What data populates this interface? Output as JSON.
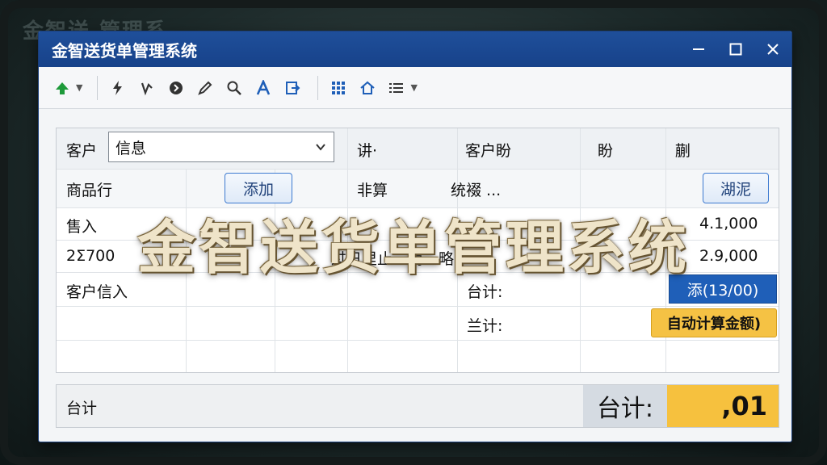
{
  "background": {
    "title": "金智送 管理系"
  },
  "window": {
    "title": "金智送货单管理系统"
  },
  "toolbar": {
    "icons": [
      "up-arrow-icon",
      "dropdown-icon",
      "lightning-icon",
      "hook-icon",
      "circle-icon",
      "pen-icon",
      "search-icon",
      "text-icon",
      "export-icon",
      "grid-icon",
      "home-icon",
      "list-icon"
    ]
  },
  "form": {
    "row1": {
      "label": "客户",
      "combo_value": "信息",
      "col3": "讲·",
      "col4": "客户盼",
      "col5": "盼",
      "col6": "蒯"
    },
    "row2": {
      "label": "商品行",
      "add_button": "添加",
      "col3": "非算",
      "col4": "统裰 ...",
      "right_button": "湖泥"
    },
    "row3": {
      "c1": "售入",
      "c4": "…",
      "value": "4.1,000"
    },
    "row4": {
      "c1": "2Σ700",
      "c2": "过日里止　筒…略",
      "value": "2.9,000"
    },
    "row5": {
      "c1": "客户信入",
      "subtotal_label": "台计:",
      "blue_button": "添(13/00)"
    },
    "row6": {
      "total_label": "兰计:",
      "auto_button": "自动计算金额)"
    }
  },
  "footer": {
    "label": "台计",
    "total_label": "台计:",
    "total_value": ",01"
  },
  "overlay": {
    "text": "金智送货单管理系统"
  },
  "colors": {
    "titlebar": "#1f4f9a",
    "accent_blue": "#1f5fb8",
    "amber": "#f6c13e"
  }
}
